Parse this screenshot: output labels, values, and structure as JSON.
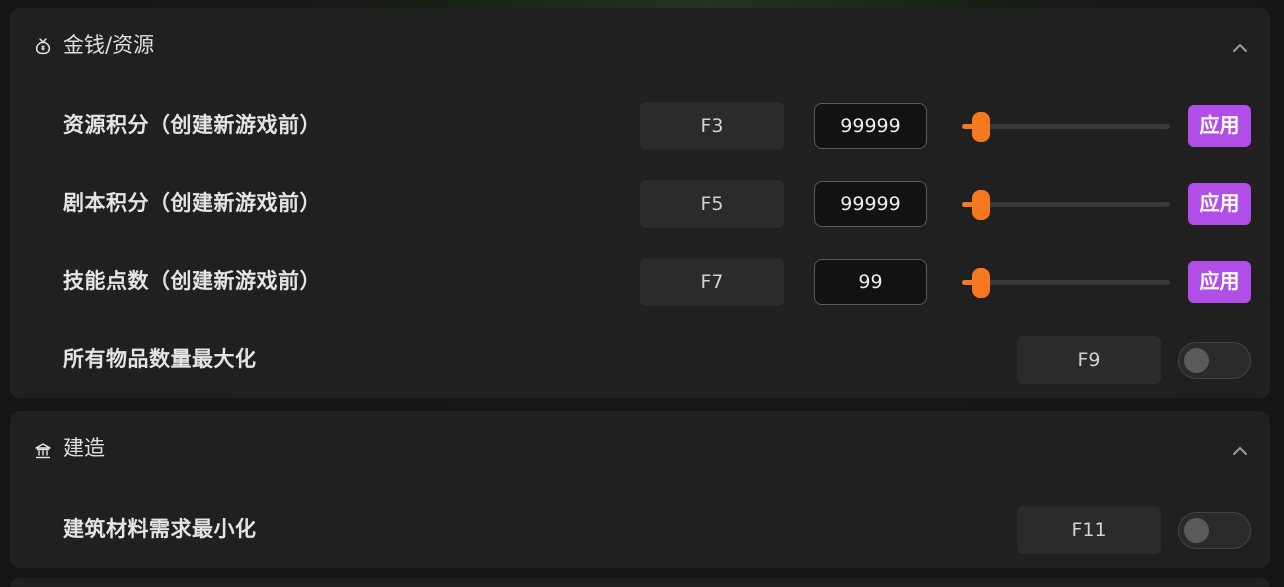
{
  "sections": [
    {
      "title": "金钱/资源",
      "icon": "money-bag-icon",
      "rows": [
        {
          "label": "资源积分（创建新游戏前）",
          "hotkey": "F3",
          "value": "99999",
          "slider_level": 0.08,
          "apply": "应用"
        },
        {
          "label": "剧本积分（创建新游戏前）",
          "hotkey": "F5",
          "value": "99999",
          "slider_level": 0.08,
          "apply": "应用"
        },
        {
          "label": "技能点数（创建新游戏前）",
          "hotkey": "F7",
          "value": "99",
          "slider_level": 0.08,
          "apply": "应用"
        },
        {
          "label": "所有物品数量最大化",
          "hotkey": "F9",
          "toggle": false
        }
      ]
    },
    {
      "title": "建造",
      "icon": "building-icon",
      "rows": [
        {
          "label": "建筑材料需求最小化",
          "hotkey": "F11",
          "toggle": false
        }
      ]
    }
  ],
  "colors": {
    "accent_apply": "#b24ee8",
    "slider": "#f57a1f",
    "panel_bg": "#202020"
  }
}
